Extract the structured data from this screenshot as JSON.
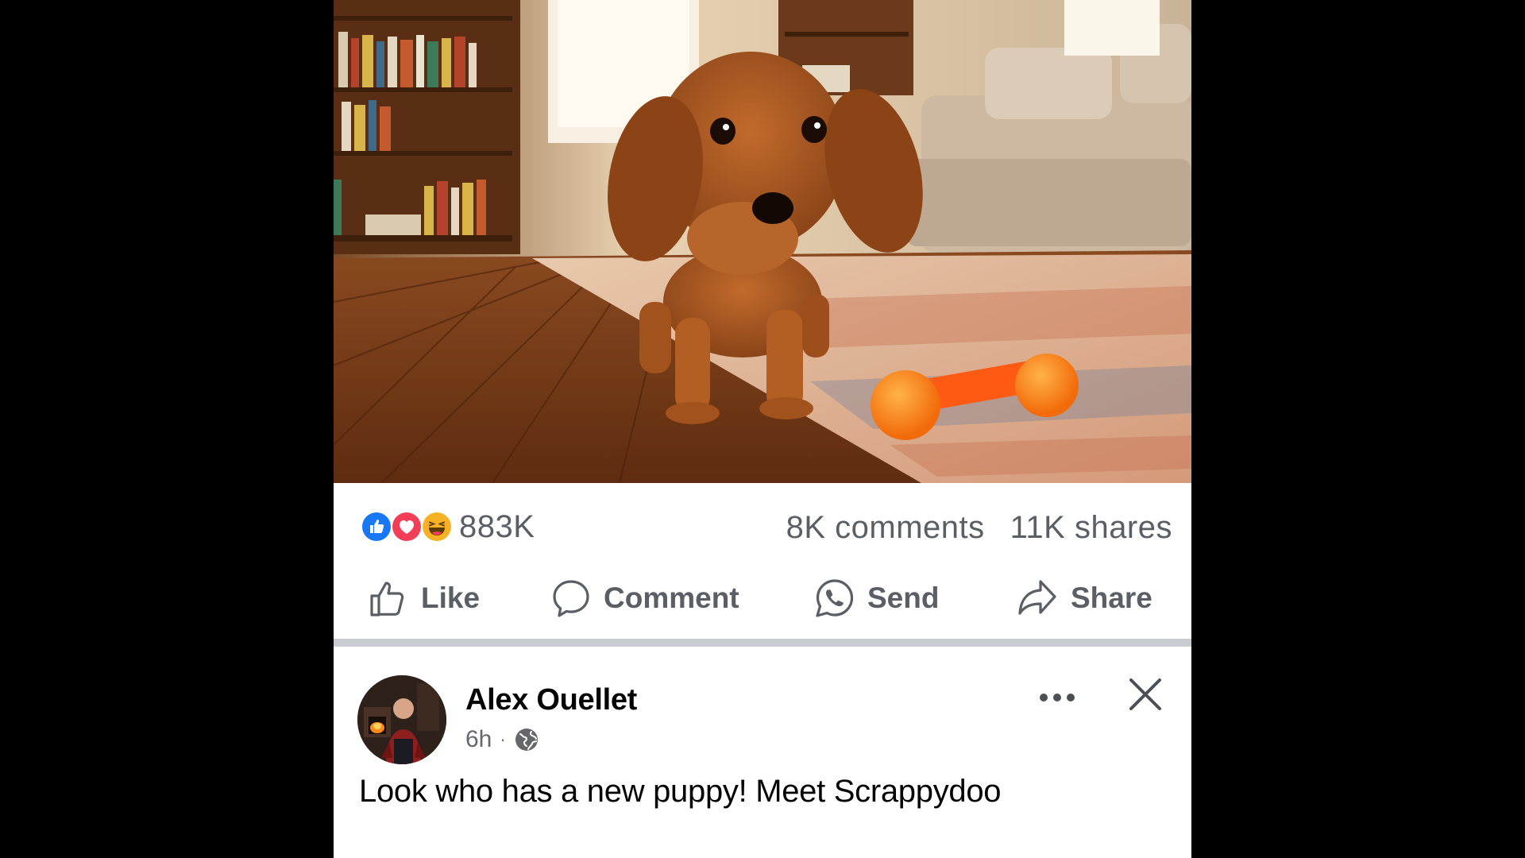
{
  "post": {
    "photo": {
      "alt_icon": "puppy-photo",
      "subject": "dachshund puppy with orange bone toy"
    },
    "stats": {
      "reaction_icons": [
        "like-reaction-icon",
        "love-reaction-icon",
        "haha-reaction-icon"
      ],
      "reaction_count": "883K",
      "comments": "8K comments",
      "shares": "11K shares"
    },
    "actions": {
      "like": "Like",
      "comment": "Comment",
      "send": "Send",
      "share": "Share"
    }
  },
  "next_post": {
    "author": "Alex Ouellet",
    "time": "6h",
    "separator": "·",
    "audience_icon": "globe-icon",
    "text": "Look who has a new puppy! Meet Scrappydoo"
  },
  "colors": {
    "like_blue": "#1877f2",
    "love_red": "#f33e58",
    "haha_yellow": "#f7b125",
    "text_secondary": "#65676b",
    "divider": "#c8cbd0"
  }
}
